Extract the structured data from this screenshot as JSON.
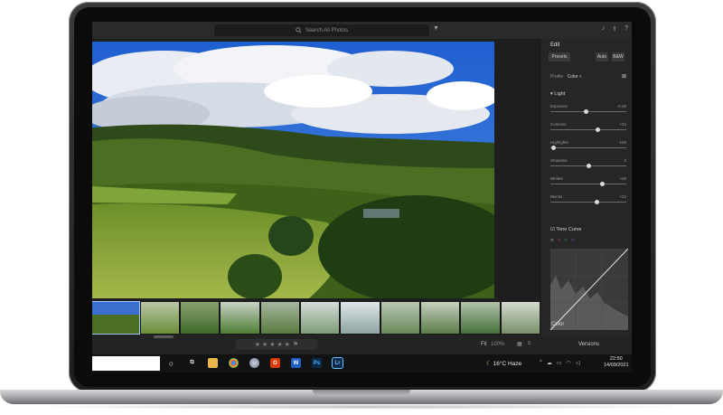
{
  "topbar": {
    "search_placeholder": "Search All Photos"
  },
  "edit_panel": {
    "title": "Edit",
    "presets_label": "Presets",
    "auto_label": "Auto",
    "bw_label": "B&W",
    "profile_label": "Profile",
    "profile_value": "Color",
    "light_section": "Light",
    "sliders": [
      {
        "label": "Exposure",
        "value": "-0.36",
        "position": 0.47
      },
      {
        "label": "Contrast",
        "value": "+34",
        "position": 0.62
      },
      {
        "label": "Highlights",
        "value": "-100",
        "position": 0.04
      },
      {
        "label": "Shadows",
        "value": "0",
        "position": 0.5
      },
      {
        "label": "Whites",
        "value": "+36",
        "position": 0.68
      },
      {
        "label": "Blacks",
        "value": "+22",
        "position": 0.61
      }
    ],
    "tone_curve_label": "Tone Curve",
    "color_section": "Color"
  },
  "bottom_bar": {
    "fit_label": "Fit",
    "zoom_label": "100%",
    "versions_label": "Versions",
    "stars": "★ ★ ★ ★ ★"
  },
  "taskbar": {
    "temperature": "16°C",
    "weather": "Haze",
    "time": "22:50",
    "date": "14/09/2021",
    "apps": [
      "Ps",
      "Lr"
    ]
  }
}
